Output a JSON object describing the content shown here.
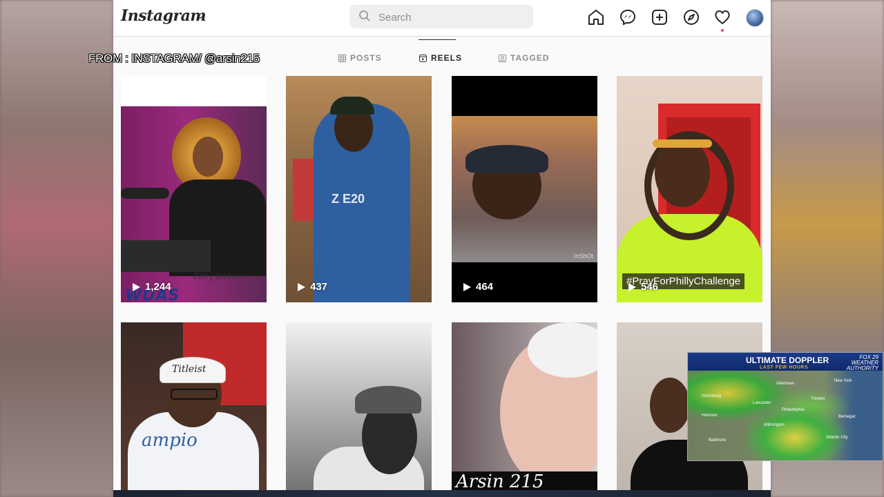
{
  "app": {
    "logo_text": "Instagram"
  },
  "search": {
    "placeholder": "Search"
  },
  "nav_icons": [
    "home-icon",
    "messenger-icon",
    "new-post-icon",
    "explore-icon",
    "activity-heart-icon",
    "profile-avatar"
  ],
  "profile_tabs": [
    {
      "label": "POSTS",
      "icon": "grid-icon",
      "active": false
    },
    {
      "label": "REELS",
      "icon": "reels-icon",
      "active": true
    },
    {
      "label": "TAGGED",
      "icon": "tagged-icon",
      "active": false
    }
  ],
  "reels": [
    {
      "views": "1,244",
      "overlay_text": "Patty Jackson",
      "logo_text": "WDAS"
    },
    {
      "views": "437",
      "shirt_text": "Z E20"
    },
    {
      "views": "464",
      "watermark": "InShOt"
    },
    {
      "views": "546",
      "hashtag": "#PrayForPhillyChallenge"
    },
    {
      "cap_text": "Titleist",
      "shirt_text": "ampio"
    },
    {},
    {
      "caption": "Arsin 215"
    },
    {}
  ],
  "overlay": {
    "source_credit": "FROM : INSTAGRAM/ @arsin215"
  },
  "doppler": {
    "title": "ULTIMATE DOPPLER",
    "subtitle": "LAST FEW HOURS",
    "brand_line1": "FOX 29",
    "brand_line2": "WEATHER",
    "brand_line3": "AUTHORITY",
    "cities": [
      "Allentown",
      "New York",
      "Harrisburg",
      "Lancaster",
      "Hanover",
      "Philadelphia",
      "Trenton",
      "Barnegat",
      "Baltimore",
      "Wilmington",
      "Atlantic City"
    ]
  },
  "colors": {
    "text_primary": "#262626",
    "text_secondary": "#8e8e8e",
    "notification": "#ed4956",
    "doppler_blue": "#1b3a8a"
  }
}
